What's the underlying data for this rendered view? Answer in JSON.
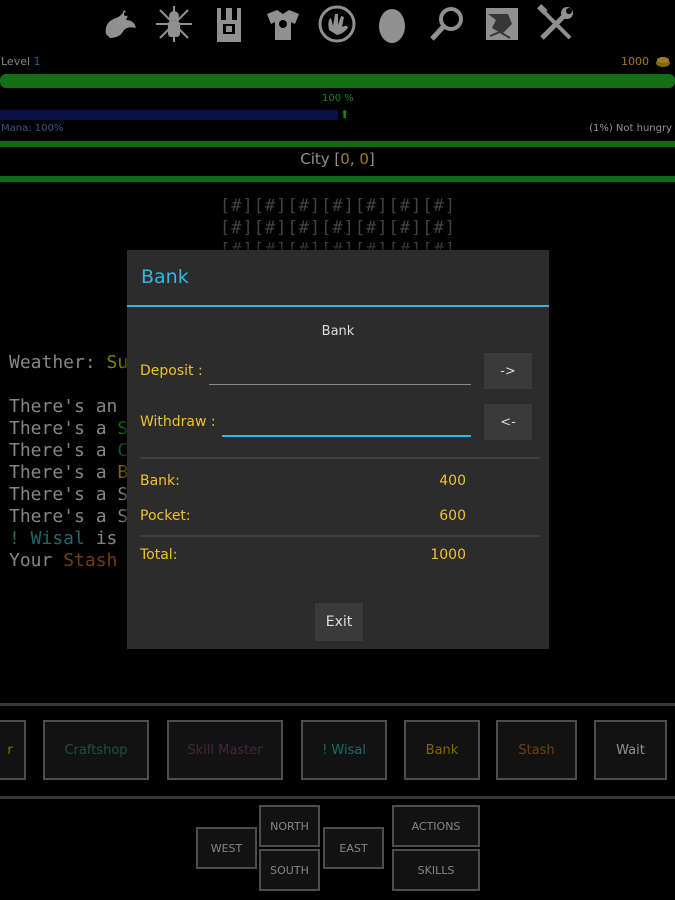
{
  "top_icons": [
    "dragon-icon",
    "character-icon",
    "inventory-icon",
    "armor-icon",
    "hand-icon",
    "egg-icon",
    "search-icon",
    "map-icon",
    "tools-icon"
  ],
  "status": {
    "level_label": "Level ",
    "level_value": "1",
    "gold": "1000",
    "health_percent_label": "100 %",
    "mana_label": "Mana: 100%",
    "hunger_label": "(1%) Not hungry",
    "health_fill": 1.0,
    "mana_fill": 0.5
  },
  "location": {
    "prefix": "City [",
    "x": "0",
    "sep": ", ",
    "y": "0",
    "suffix": "]"
  },
  "map_rows": [
    "[#][#][#][#][#][#][#]",
    "[#][#][#][#][#][#][#]",
    "[#][#][#][#][#][#][#]"
  ],
  "log": {
    "weather_prefix": "Weather: ",
    "weather_value": "Su",
    "lines": [
      {
        "prefix": "There's an",
        "rest": ""
      },
      {
        "prefix": "There's a ",
        "rest": "S"
      },
      {
        "prefix": "There's a ",
        "rest": "C"
      },
      {
        "prefix": "There's a ",
        "rest": "B"
      },
      {
        "prefix": "There's a ",
        "rest": "S"
      },
      {
        "prefix": "There's a ",
        "rest": "S"
      }
    ],
    "wisal_line": "! Wisal",
    "wisal_rest": " is",
    "stash_prefix": "Your ",
    "stash_value": "Stash"
  },
  "dialog": {
    "title": "Bank",
    "subtitle": "Bank",
    "deposit_label": "Deposit :",
    "deposit_value": "",
    "deposit_button": "->",
    "withdraw_label": "Withdraw :",
    "withdraw_value": "",
    "withdraw_button": "<-",
    "bank_label": "Bank:",
    "bank_value": "400",
    "pocket_label": "Pocket:",
    "pocket_value": "600",
    "total_label": "Total:",
    "total_value": "1000",
    "exit_label": "Exit"
  },
  "actions": [
    {
      "label": "r",
      "color": "#c8b400"
    },
    {
      "label": "Craftshop",
      "color": "#2e7d5a"
    },
    {
      "label": "Skill Master",
      "color": "#6a3d5a"
    },
    {
      "label": "! Wisal",
      "color": "#2aa3a3"
    },
    {
      "label": "Bank",
      "color": "#c8a000"
    },
    {
      "label": "Stash",
      "color": "#b0601a"
    },
    {
      "label": "Wait",
      "color": "#dddddd"
    }
  ],
  "nav": {
    "north": "NORTH",
    "south": "SOUTH",
    "west": "WEST",
    "east": "EAST",
    "actions": "ACTIONS",
    "skills": "SKILLS"
  }
}
